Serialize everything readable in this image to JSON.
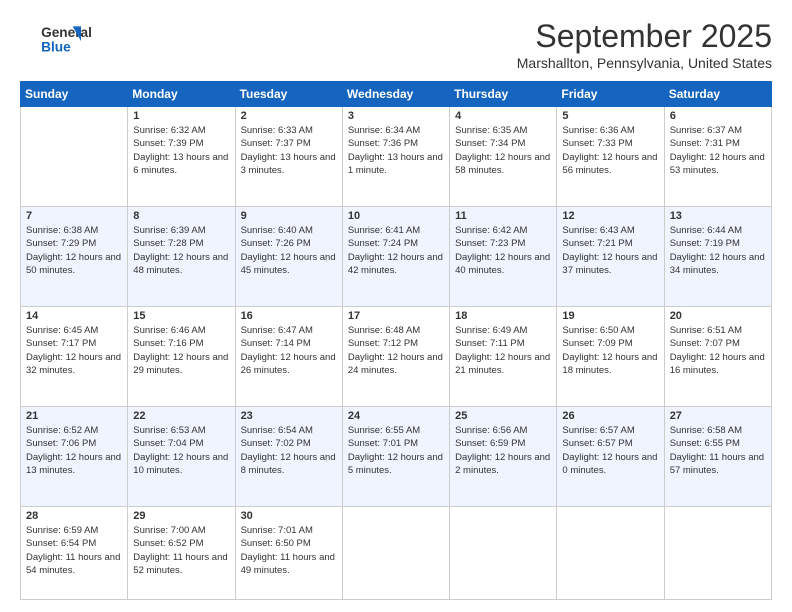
{
  "header": {
    "logo_line1": "General",
    "logo_line2": "Blue",
    "month": "September 2025",
    "location": "Marshallton, Pennsylvania, United States"
  },
  "days_of_week": [
    "Sunday",
    "Monday",
    "Tuesday",
    "Wednesday",
    "Thursday",
    "Friday",
    "Saturday"
  ],
  "weeks": [
    [
      {
        "day": "",
        "sunrise": "",
        "sunset": "",
        "daylight": ""
      },
      {
        "day": "1",
        "sunrise": "Sunrise: 6:32 AM",
        "sunset": "Sunset: 7:39 PM",
        "daylight": "Daylight: 13 hours and 6 minutes."
      },
      {
        "day": "2",
        "sunrise": "Sunrise: 6:33 AM",
        "sunset": "Sunset: 7:37 PM",
        "daylight": "Daylight: 13 hours and 3 minutes."
      },
      {
        "day": "3",
        "sunrise": "Sunrise: 6:34 AM",
        "sunset": "Sunset: 7:36 PM",
        "daylight": "Daylight: 13 hours and 1 minute."
      },
      {
        "day": "4",
        "sunrise": "Sunrise: 6:35 AM",
        "sunset": "Sunset: 7:34 PM",
        "daylight": "Daylight: 12 hours and 58 minutes."
      },
      {
        "day": "5",
        "sunrise": "Sunrise: 6:36 AM",
        "sunset": "Sunset: 7:33 PM",
        "daylight": "Daylight: 12 hours and 56 minutes."
      },
      {
        "day": "6",
        "sunrise": "Sunrise: 6:37 AM",
        "sunset": "Sunset: 7:31 PM",
        "daylight": "Daylight: 12 hours and 53 minutes."
      }
    ],
    [
      {
        "day": "7",
        "sunrise": "Sunrise: 6:38 AM",
        "sunset": "Sunset: 7:29 PM",
        "daylight": "Daylight: 12 hours and 50 minutes."
      },
      {
        "day": "8",
        "sunrise": "Sunrise: 6:39 AM",
        "sunset": "Sunset: 7:28 PM",
        "daylight": "Daylight: 12 hours and 48 minutes."
      },
      {
        "day": "9",
        "sunrise": "Sunrise: 6:40 AM",
        "sunset": "Sunset: 7:26 PM",
        "daylight": "Daylight: 12 hours and 45 minutes."
      },
      {
        "day": "10",
        "sunrise": "Sunrise: 6:41 AM",
        "sunset": "Sunset: 7:24 PM",
        "daylight": "Daylight: 12 hours and 42 minutes."
      },
      {
        "day": "11",
        "sunrise": "Sunrise: 6:42 AM",
        "sunset": "Sunset: 7:23 PM",
        "daylight": "Daylight: 12 hours and 40 minutes."
      },
      {
        "day": "12",
        "sunrise": "Sunrise: 6:43 AM",
        "sunset": "Sunset: 7:21 PM",
        "daylight": "Daylight: 12 hours and 37 minutes."
      },
      {
        "day": "13",
        "sunrise": "Sunrise: 6:44 AM",
        "sunset": "Sunset: 7:19 PM",
        "daylight": "Daylight: 12 hours and 34 minutes."
      }
    ],
    [
      {
        "day": "14",
        "sunrise": "Sunrise: 6:45 AM",
        "sunset": "Sunset: 7:17 PM",
        "daylight": "Daylight: 12 hours and 32 minutes."
      },
      {
        "day": "15",
        "sunrise": "Sunrise: 6:46 AM",
        "sunset": "Sunset: 7:16 PM",
        "daylight": "Daylight: 12 hours and 29 minutes."
      },
      {
        "day": "16",
        "sunrise": "Sunrise: 6:47 AM",
        "sunset": "Sunset: 7:14 PM",
        "daylight": "Daylight: 12 hours and 26 minutes."
      },
      {
        "day": "17",
        "sunrise": "Sunrise: 6:48 AM",
        "sunset": "Sunset: 7:12 PM",
        "daylight": "Daylight: 12 hours and 24 minutes."
      },
      {
        "day": "18",
        "sunrise": "Sunrise: 6:49 AM",
        "sunset": "Sunset: 7:11 PM",
        "daylight": "Daylight: 12 hours and 21 minutes."
      },
      {
        "day": "19",
        "sunrise": "Sunrise: 6:50 AM",
        "sunset": "Sunset: 7:09 PM",
        "daylight": "Daylight: 12 hours and 18 minutes."
      },
      {
        "day": "20",
        "sunrise": "Sunrise: 6:51 AM",
        "sunset": "Sunset: 7:07 PM",
        "daylight": "Daylight: 12 hours and 16 minutes."
      }
    ],
    [
      {
        "day": "21",
        "sunrise": "Sunrise: 6:52 AM",
        "sunset": "Sunset: 7:06 PM",
        "daylight": "Daylight: 12 hours and 13 minutes."
      },
      {
        "day": "22",
        "sunrise": "Sunrise: 6:53 AM",
        "sunset": "Sunset: 7:04 PM",
        "daylight": "Daylight: 12 hours and 10 minutes."
      },
      {
        "day": "23",
        "sunrise": "Sunrise: 6:54 AM",
        "sunset": "Sunset: 7:02 PM",
        "daylight": "Daylight: 12 hours and 8 minutes."
      },
      {
        "day": "24",
        "sunrise": "Sunrise: 6:55 AM",
        "sunset": "Sunset: 7:01 PM",
        "daylight": "Daylight: 12 hours and 5 minutes."
      },
      {
        "day": "25",
        "sunrise": "Sunrise: 6:56 AM",
        "sunset": "Sunset: 6:59 PM",
        "daylight": "Daylight: 12 hours and 2 minutes."
      },
      {
        "day": "26",
        "sunrise": "Sunrise: 6:57 AM",
        "sunset": "Sunset: 6:57 PM",
        "daylight": "Daylight: 12 hours and 0 minutes."
      },
      {
        "day": "27",
        "sunrise": "Sunrise: 6:58 AM",
        "sunset": "Sunset: 6:55 PM",
        "daylight": "Daylight: 11 hours and 57 minutes."
      }
    ],
    [
      {
        "day": "28",
        "sunrise": "Sunrise: 6:59 AM",
        "sunset": "Sunset: 6:54 PM",
        "daylight": "Daylight: 11 hours and 54 minutes."
      },
      {
        "day": "29",
        "sunrise": "Sunrise: 7:00 AM",
        "sunset": "Sunset: 6:52 PM",
        "daylight": "Daylight: 11 hours and 52 minutes."
      },
      {
        "day": "30",
        "sunrise": "Sunrise: 7:01 AM",
        "sunset": "Sunset: 6:50 PM",
        "daylight": "Daylight: 11 hours and 49 minutes."
      },
      {
        "day": "",
        "sunrise": "",
        "sunset": "",
        "daylight": ""
      },
      {
        "day": "",
        "sunrise": "",
        "sunset": "",
        "daylight": ""
      },
      {
        "day": "",
        "sunrise": "",
        "sunset": "",
        "daylight": ""
      },
      {
        "day": "",
        "sunrise": "",
        "sunset": "",
        "daylight": ""
      }
    ]
  ]
}
